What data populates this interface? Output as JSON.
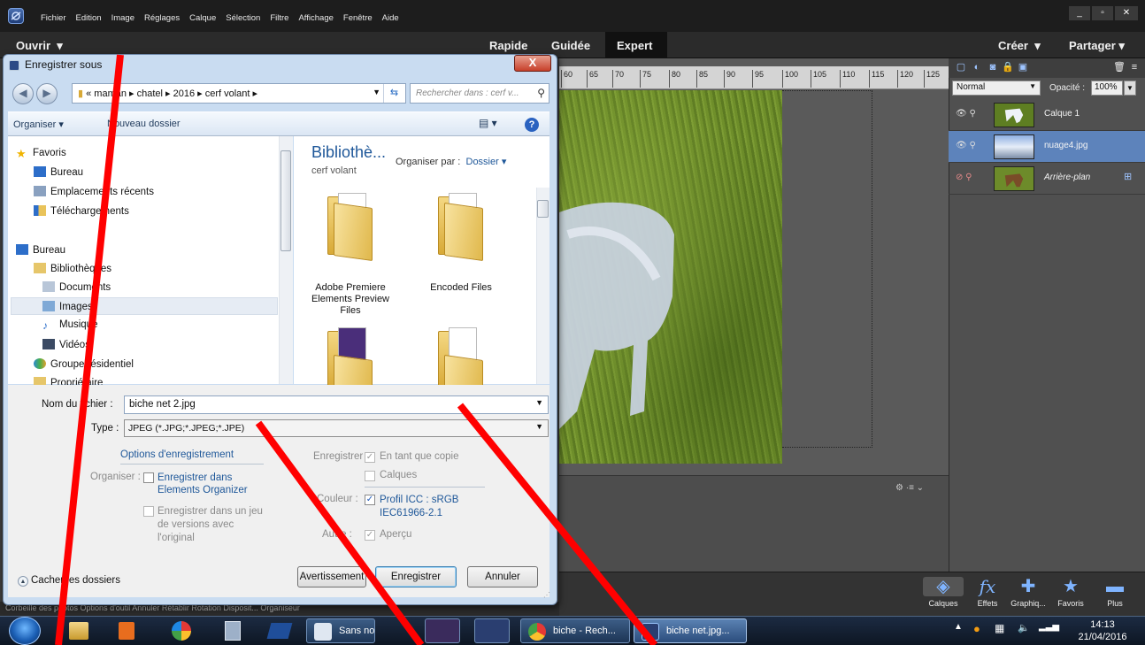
{
  "app": {
    "menu": [
      "Fichier",
      "Edition",
      "Image",
      "Réglages",
      "Calque",
      "Sélection",
      "Filtre",
      "Affichage",
      "Fenêtre",
      "Aide"
    ],
    "window_controls": [
      "_",
      "▫",
      "✕"
    ],
    "open_label": "Ouvrir",
    "modes": [
      "Rapide",
      "Guidée",
      "Expert"
    ],
    "active_mode": "Expert",
    "create_label": "Créer",
    "share_label": "Partager",
    "ruler_ticks": [
      "60",
      "65",
      "70",
      "75",
      "80",
      "85",
      "90",
      "95",
      "100",
      "105",
      "110",
      "115",
      "120",
      "125"
    ],
    "panel_menu_icon": "⚙ ·≡ ⌄"
  },
  "layers_panel": {
    "blend_mode": "Normal",
    "opacity_label": "Opacité :",
    "opacity_value": "100%",
    "layers": [
      {
        "name": "Calque 1",
        "visible": true,
        "selected": false
      },
      {
        "name": "nuage4.jpg",
        "visible": true,
        "selected": true
      },
      {
        "name": "Arrière-plan",
        "visible": false,
        "selected": false
      }
    ]
  },
  "panel_buttons": [
    {
      "label": "Calques",
      "icon": "layers-icon"
    },
    {
      "label": "Effets",
      "icon": "fx-icon"
    },
    {
      "label": "Graphiq...",
      "icon": "plus-icon"
    },
    {
      "label": "Favoris",
      "icon": "star-icon"
    },
    {
      "label": "Plus",
      "icon": "more-icon"
    }
  ],
  "bin_bar": "Corbeille des photos   Options d'outil   Annuler   Rétablir   Rotation   Disposit...   Organiseur",
  "dialog": {
    "title": "Enregistrer sous",
    "close": "X",
    "address": "«  maman ▸ chatel ▸ 2016 ▸ cerf volant ▸",
    "search_placeholder": "Rechercher dans : cerf v...",
    "organize_label": "Organiser ▾",
    "new_folder_label": "Nouveau dossier",
    "nav_items": [
      "Favoris",
      "Bureau",
      "Emplacements récents",
      "Téléchargements",
      "Bureau",
      "Bibliothèques",
      "Documents",
      "Images",
      "Musique",
      "Vidéos",
      "Groupe résidentiel",
      "Propriétaire"
    ],
    "library_title": "Bibliothè...",
    "library_sub": "cerf volant",
    "organize_by_label": "Organiser par :",
    "organize_by_value": "Dossier ▾",
    "folders": [
      "Adobe Premiere Elements Preview Files",
      "Encoded Files"
    ],
    "filename_label": "Nom du fichier :",
    "filename_value": "biche net 2.jpg",
    "type_label": "Type :",
    "type_value": "JPEG (*.JPG;*.JPEG;*.JPE)",
    "options_header": "Options d'enregistrement",
    "organize_label2": "Organiser :",
    "organizer_option": "Enregistrer dans Elements Organizer",
    "versions_option": "Enregistrer dans un jeu de versions avec l'original",
    "save_label": "Enregistrer :",
    "as_copy_option": "En tant que copie",
    "layers_option": "Calques",
    "color_label": "Couleur :",
    "icc_option": "Profil ICC : sRGB IEC61966-2.1",
    "other_label": "Autre :",
    "preview_option": "Aperçu",
    "hide_folders": "Cacher les dossiers",
    "warning_button": "Avertissement",
    "save_button": "Enregistrer",
    "cancel_button": "Annuler"
  },
  "taskbar": {
    "items": [
      {
        "label": "Sans nom 1 -...",
        "active": false
      },
      {
        "label": "biche - Rech...",
        "active": false
      },
      {
        "label": "biche net.jpg...",
        "active": true
      }
    ],
    "time": "14:13",
    "date": "21/04/2016",
    "tray_up": "▲"
  },
  "colors": {
    "annotation": "#ff0000",
    "selected_layer": "#5d83bb",
    "link": "#1e5799"
  }
}
